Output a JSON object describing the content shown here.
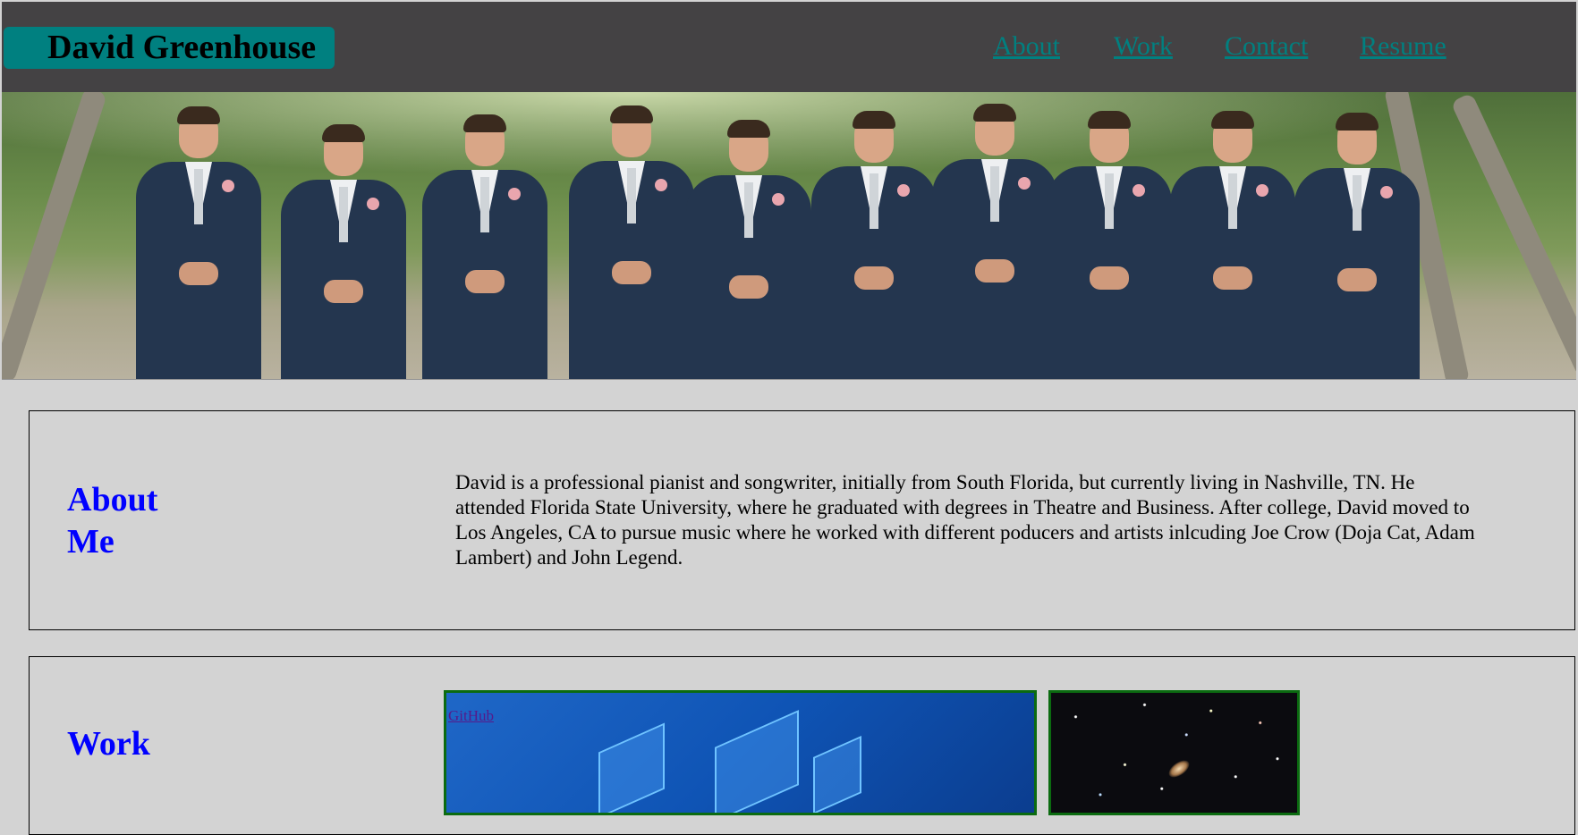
{
  "header": {
    "brand": "David Greenhouse",
    "nav": [
      "About",
      "Work",
      "Contact",
      "Resume"
    ]
  },
  "hero": {
    "image": "groomsmen-photo"
  },
  "about": {
    "title_line1": "About",
    "title_line2": "Me",
    "text": "David is a professional pianist and songwriter, initially from South Florida, but currently living in Nashville, TN. He attended Florida State University, where he graduated with degrees in Theatre and Business. After college, David moved to Los Angeles, CA to pursue music where he worked with different poducers and artists inlcuding Joe Crow (Doja Cat, Adam Lambert) and John Legend."
  },
  "work": {
    "title": "Work",
    "github_link": "GitHub"
  },
  "colors": {
    "background": "#d3d3d3",
    "header": "#444244",
    "brand_bg": "#008080",
    "nav_link": "#008080",
    "heading": "#0000ff",
    "tile_border": "#0b6b10"
  }
}
